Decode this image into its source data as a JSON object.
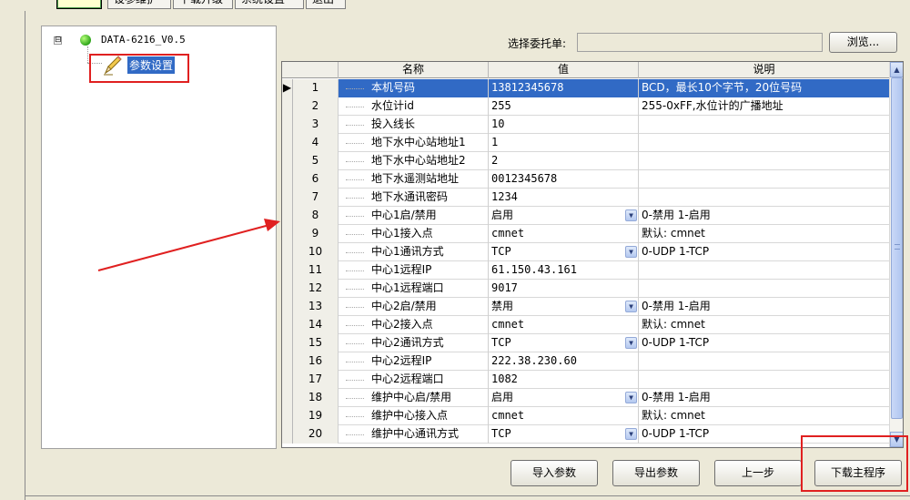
{
  "toolbar": {
    "items": [
      "",
      "设参维护",
      "下载升级",
      "系统设置",
      "退出"
    ]
  },
  "tree": {
    "expander": "⊟",
    "root_label": "DATA-6216_V0.5",
    "child_label": "参数设置"
  },
  "delegate": {
    "label": "选择委托单:",
    "value": "",
    "browse_label": "浏览..."
  },
  "grid": {
    "headers": {
      "name": "名称",
      "value": "值",
      "desc": "说明"
    },
    "rows": [
      {
        "idx": "1",
        "name": "本机号码",
        "value": "13812345678",
        "desc": "BCD，最长10个字节，20位号码",
        "selected": true,
        "dropdown": false
      },
      {
        "idx": "2",
        "name": "水位计id",
        "value": "255",
        "desc": "255-0xFF,水位计的广播地址",
        "dropdown": false
      },
      {
        "idx": "3",
        "name": "投入线长",
        "value": "10",
        "desc": "",
        "dropdown": false
      },
      {
        "idx": "4",
        "name": "地下水中心站地址1",
        "value": "1",
        "desc": "",
        "dropdown": false
      },
      {
        "idx": "5",
        "name": "地下水中心站地址2",
        "value": "2",
        "desc": "",
        "dropdown": false
      },
      {
        "idx": "6",
        "name": "地下水遥测站地址",
        "value": "0012345678",
        "desc": "",
        "dropdown": false
      },
      {
        "idx": "7",
        "name": "地下水通讯密码",
        "value": "1234",
        "desc": "",
        "dropdown": false
      },
      {
        "idx": "8",
        "name": "中心1启/禁用",
        "value": "启用",
        "desc": "0-禁用 1-启用",
        "dropdown": true
      },
      {
        "idx": "9",
        "name": "中心1接入点",
        "value": "cmnet",
        "desc": "默认: cmnet",
        "dropdown": false
      },
      {
        "idx": "10",
        "name": "中心1通讯方式",
        "value": "TCP",
        "desc": "0-UDP  1-TCP",
        "dropdown": true
      },
      {
        "idx": "11",
        "name": "中心1远程IP",
        "value": "61.150.43.161",
        "desc": "",
        "dropdown": false
      },
      {
        "idx": "12",
        "name": "中心1远程端口",
        "value": "9017",
        "desc": "",
        "dropdown": false
      },
      {
        "idx": "13",
        "name": "中心2启/禁用",
        "value": "禁用",
        "desc": "0-禁用 1-启用",
        "dropdown": true
      },
      {
        "idx": "14",
        "name": "中心2接入点",
        "value": "cmnet",
        "desc": "默认: cmnet",
        "dropdown": false
      },
      {
        "idx": "15",
        "name": "中心2通讯方式",
        "value": "TCP",
        "desc": "0-UDP  1-TCP",
        "dropdown": true
      },
      {
        "idx": "16",
        "name": "中心2远程IP",
        "value": "222.38.230.60",
        "desc": "",
        "dropdown": false
      },
      {
        "idx": "17",
        "name": "中心2远程端口",
        "value": "1082",
        "desc": "",
        "dropdown": false
      },
      {
        "idx": "18",
        "name": "维护中心启/禁用",
        "value": "启用",
        "desc": "0-禁用 1-启用",
        "dropdown": true
      },
      {
        "idx": "19",
        "name": "维护中心接入点",
        "value": "cmnet",
        "desc": "默认: cmnet",
        "dropdown": false
      },
      {
        "idx": "20",
        "name": "维护中心通讯方式",
        "value": "TCP",
        "desc": "0-UDP  1-TCP",
        "dropdown": true
      }
    ]
  },
  "buttons": {
    "import": "导入参数",
    "export": "导出参数",
    "prev": "上一步",
    "download": "下载主程序"
  },
  "colors": {
    "selection": "#316ac5",
    "annotation": "#e02020",
    "status_dot": "#2ea51a"
  }
}
